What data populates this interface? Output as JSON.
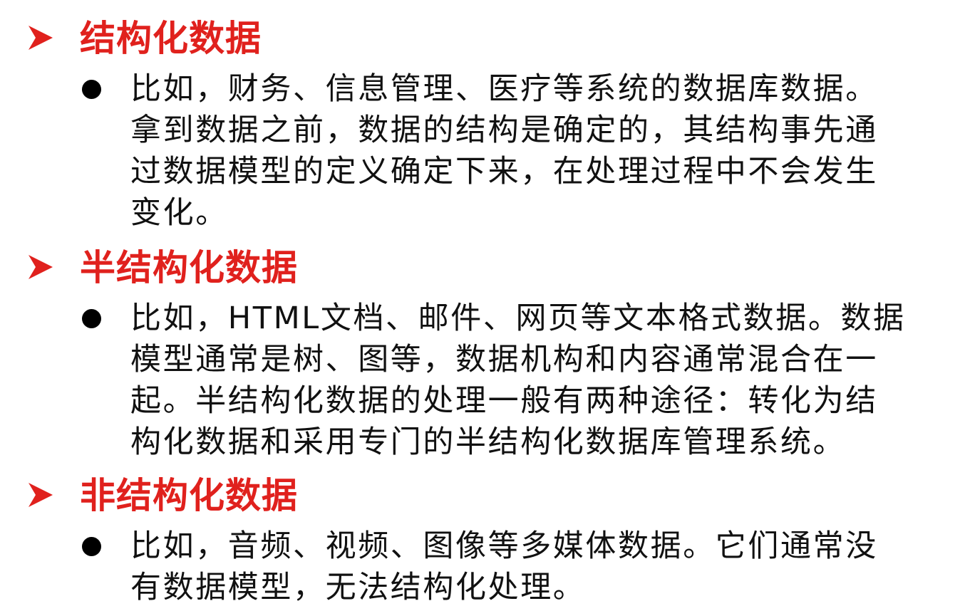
{
  "colors": {
    "heading": "#e0211d",
    "text": "#111111",
    "bullet": "#000000"
  },
  "sections": [
    {
      "heading": "结构化数据",
      "lines": [
        "比如，财务、信息管理、医疗等系统的数据库数据。",
        "拿到数据之前，数据的结构是确定的，其结构事先通",
        "过数据模型的定义确定下来，在处理过程中不会发生",
        "变化。"
      ]
    },
    {
      "heading": "半结构化数据",
      "lines": [
        "比如，HTML文档、邮件、网页等文本格式数据。数据",
        "模型通常是树、图等，数据机构和内容通常混合在一",
        "起。半结构化数据的处理一般有两种途径：转化为结",
        "构化数据和采用专门的半结构化数据库管理系统。"
      ]
    },
    {
      "heading": "非结构化数据",
      "lines": [
        "比如，音频、视频、图像等多媒体数据。它们通常没",
        "有数据模型，无法结构化处理。"
      ]
    }
  ]
}
